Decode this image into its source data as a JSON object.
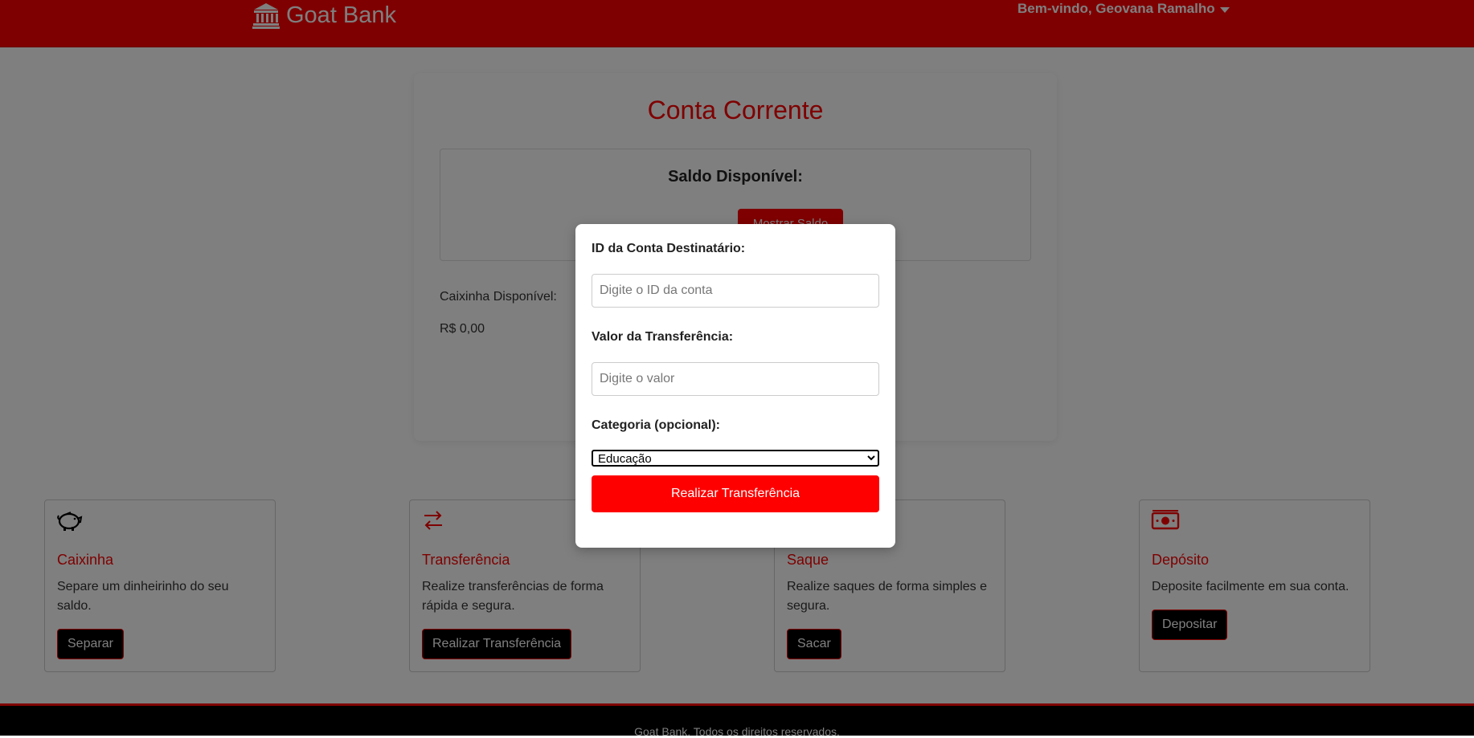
{
  "header": {
    "brand": "Goat Bank",
    "brand_icon": "bank-icon",
    "welcome": "Bem-vindo, Geovana Ramalho",
    "colors": {
      "primary": "#ff0000",
      "dark": "#000000"
    }
  },
  "account": {
    "title": "Conta Corrente",
    "balance_label": "Saldo Disponível:",
    "show_balance_button": "Mostrar Saldo",
    "piggy_label": "Caixinha Disponível:",
    "piggy_value": "R$ 0,00"
  },
  "features": [
    {
      "icon": "piggy-bank-icon",
      "title": "Caixinha",
      "description": "Separe um dinheirinho do seu saldo.",
      "button": "Separar"
    },
    {
      "icon": "transfer-arrows-icon",
      "title": "Transferência",
      "description": "Realize transferências de forma rápida e segura.",
      "button": "Realizar Transferência"
    },
    {
      "icon": "cash-withdraw-icon",
      "title": "Saque",
      "description": "Realize saques de forma simples e segura.",
      "button": "Sacar"
    },
    {
      "icon": "money-bill-icon",
      "title": "Depósito",
      "description": "Deposite facilmente em sua conta.",
      "button": "Depositar"
    }
  ],
  "modal": {
    "account_id_label": "ID da Conta Destinatário:",
    "account_id_placeholder": "Digite o ID da conta",
    "account_id_value": "",
    "amount_label": "Valor da Transferência:",
    "amount_placeholder": "Digite o valor",
    "amount_value": "",
    "category_label": "Categoria (opcional):",
    "category_selected": "Educação",
    "submit": "Realizar Transferência"
  },
  "footer": {
    "text": "Goat Bank. Todos os direitos reservados."
  }
}
